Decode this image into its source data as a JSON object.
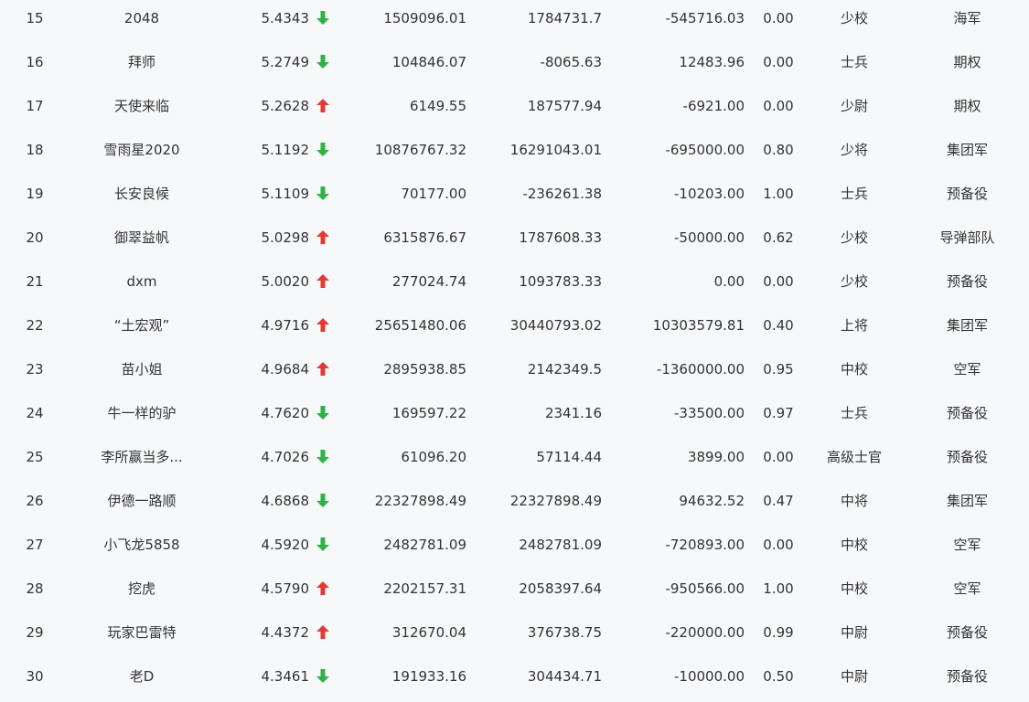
{
  "colors": {
    "up": "#e53935",
    "down": "#2fb344"
  },
  "rows": [
    {
      "rank": "15",
      "name": "2048",
      "score": "5.4343",
      "trend": "down",
      "v1": "1509096.01",
      "v2": "1784731.7",
      "v3": "-545716.03",
      "ratio": "0.00",
      "title": "少校",
      "unit": "海军"
    },
    {
      "rank": "16",
      "name": "拜师",
      "score": "5.2749",
      "trend": "down",
      "v1": "104846.07",
      "v2": "-8065.63",
      "v3": "12483.96",
      "ratio": "0.00",
      "title": "士兵",
      "unit": "期权"
    },
    {
      "rank": "17",
      "name": "天使来临",
      "score": "5.2628",
      "trend": "up",
      "v1": "6149.55",
      "v2": "187577.94",
      "v3": "-6921.00",
      "ratio": "0.00",
      "title": "少尉",
      "unit": "期权"
    },
    {
      "rank": "18",
      "name": "雪雨星2020",
      "score": "5.1192",
      "trend": "down",
      "v1": "10876767.32",
      "v2": "16291043.01",
      "v3": "-695000.00",
      "ratio": "0.80",
      "title": "少将",
      "unit": "集团军"
    },
    {
      "rank": "19",
      "name": "长安良候",
      "score": "5.1109",
      "trend": "down",
      "v1": "70177.00",
      "v2": "-236261.38",
      "v3": "-10203.00",
      "ratio": "1.00",
      "title": "士兵",
      "unit": "预备役"
    },
    {
      "rank": "20",
      "name": "御翠益帆",
      "score": "5.0298",
      "trend": "up",
      "v1": "6315876.67",
      "v2": "1787608.33",
      "v3": "-50000.00",
      "ratio": "0.62",
      "title": "少校",
      "unit": "导弹部队"
    },
    {
      "rank": "21",
      "name": "dxm",
      "score": "5.0020",
      "trend": "up",
      "v1": "277024.74",
      "v2": "1093783.33",
      "v3": "0.00",
      "ratio": "0.00",
      "title": "少校",
      "unit": "预备役"
    },
    {
      "rank": "22",
      "name": "“土宏观”",
      "score": "4.9716",
      "trend": "up",
      "v1": "25651480.06",
      "v2": "30440793.02",
      "v3": "10303579.81",
      "ratio": "0.40",
      "title": "上将",
      "unit": "集团军"
    },
    {
      "rank": "23",
      "name": "苗小姐",
      "score": "4.9684",
      "trend": "up",
      "v1": "2895938.85",
      "v2": "2142349.5",
      "v3": "-1360000.00",
      "ratio": "0.95",
      "title": "中校",
      "unit": "空军"
    },
    {
      "rank": "24",
      "name": "牛一样的驴",
      "score": "4.7620",
      "trend": "down",
      "v1": "169597.22",
      "v2": "2341.16",
      "v3": "-33500.00",
      "ratio": "0.97",
      "title": "士兵",
      "unit": "预备役"
    },
    {
      "rank": "25",
      "name": "李所赢当多...",
      "score": "4.7026",
      "trend": "down",
      "v1": "61096.20",
      "v2": "57114.44",
      "v3": "3899.00",
      "ratio": "0.00",
      "title": "高级士官",
      "unit": "预备役"
    },
    {
      "rank": "26",
      "name": "伊德一路顺",
      "score": "4.6868",
      "trend": "down",
      "v1": "22327898.49",
      "v2": "22327898.49",
      "v3": "94632.52",
      "ratio": "0.47",
      "title": "中将",
      "unit": "集团军"
    },
    {
      "rank": "27",
      "name": "小飞龙5858",
      "score": "4.5920",
      "trend": "down",
      "v1": "2482781.09",
      "v2": "2482781.09",
      "v3": "-720893.00",
      "ratio": "0.00",
      "title": "中校",
      "unit": "空军"
    },
    {
      "rank": "28",
      "name": "挖虎",
      "score": "4.5790",
      "trend": "up",
      "v1": "2202157.31",
      "v2": "2058397.64",
      "v3": "-950566.00",
      "ratio": "1.00",
      "title": "中校",
      "unit": "空军"
    },
    {
      "rank": "29",
      "name": "玩家巴雷特",
      "score": "4.4372",
      "trend": "up",
      "v1": "312670.04",
      "v2": "376738.75",
      "v3": "-220000.00",
      "ratio": "0.99",
      "title": "中尉",
      "unit": "预备役"
    },
    {
      "rank": "30",
      "name": "老D",
      "score": "4.3461",
      "trend": "down",
      "v1": "191933.16",
      "v2": "304434.71",
      "v3": "-10000.00",
      "ratio": "0.50",
      "title": "中尉",
      "unit": "预备役"
    }
  ]
}
